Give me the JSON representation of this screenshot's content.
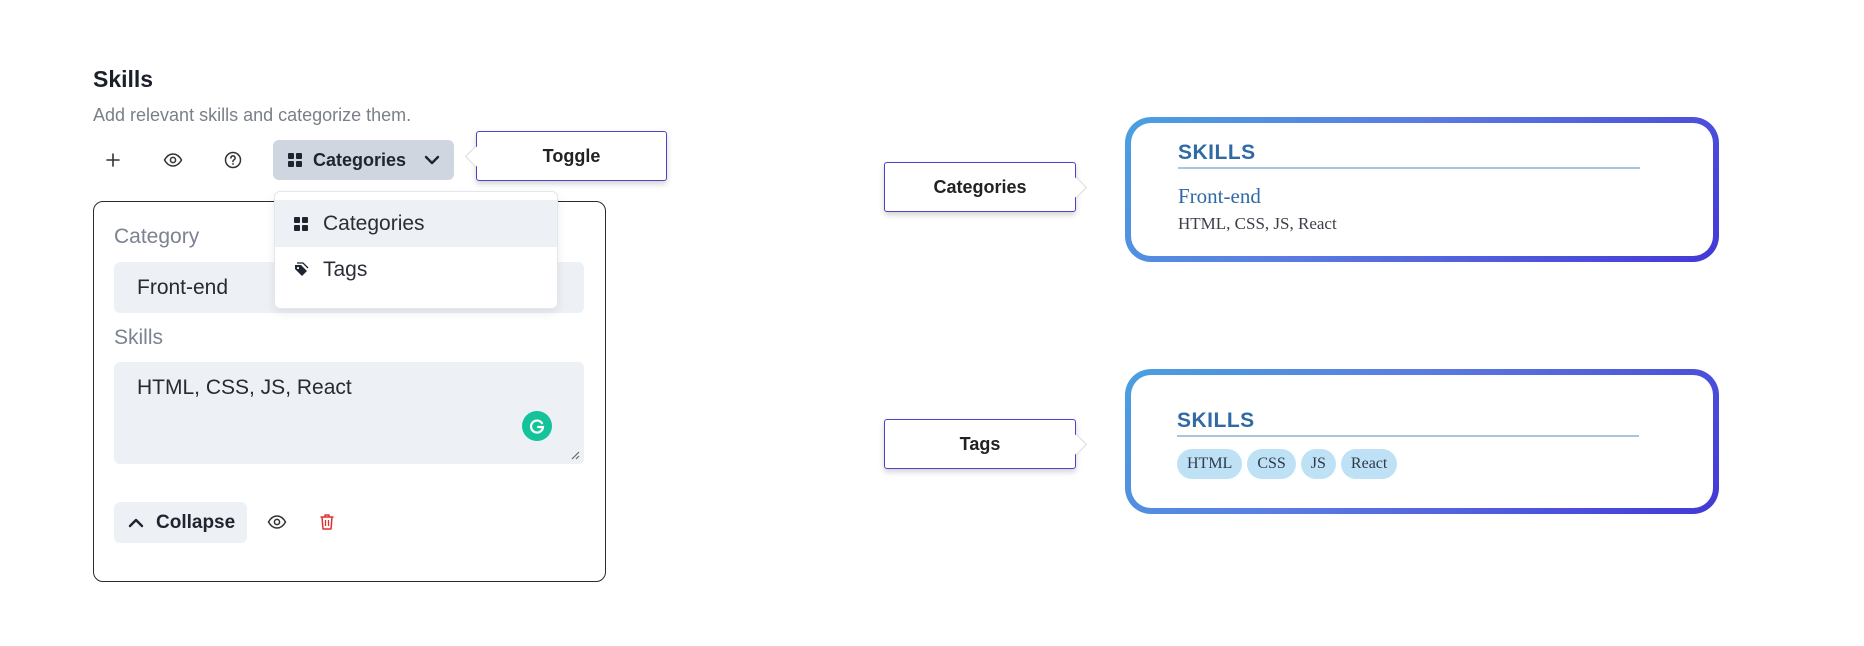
{
  "section": {
    "title": "Skills",
    "subtitle": "Add relevant skills and categorize them."
  },
  "toolbar": {
    "add_icon": "plus-icon",
    "preview_icon": "eye-icon",
    "help_icon": "question-circle-icon",
    "view_select": {
      "icon": "grid-icon",
      "label": "Categories",
      "chevron": "chevron-down-icon"
    }
  },
  "callouts": {
    "toggle": "Toggle",
    "categories": "Categories",
    "tags": "Tags"
  },
  "dropdown": {
    "options": [
      {
        "icon": "grid-icon",
        "label": "Categories",
        "selected": true
      },
      {
        "icon": "tags-icon",
        "label": "Tags",
        "selected": false
      }
    ]
  },
  "editor": {
    "category_label": "Category",
    "category_value": "Front-end",
    "skills_label": "Skills",
    "skills_value": "HTML, CSS, JS, React",
    "collapse_label": "Collapse"
  },
  "preview_categories": {
    "heading": "SKILLS",
    "category": "Front-end",
    "skills": "HTML, CSS, JS, React"
  },
  "preview_tags": {
    "heading": "SKILLS",
    "tags": [
      "HTML",
      "CSS",
      "JS",
      "React"
    ]
  },
  "colors": {
    "accent_border": "#4b44c9",
    "preview_heading": "#2f6aa6",
    "tag_fill": "#bfe1f6",
    "delete_red": "#e03131",
    "grammarly_green": "#15c39a"
  }
}
